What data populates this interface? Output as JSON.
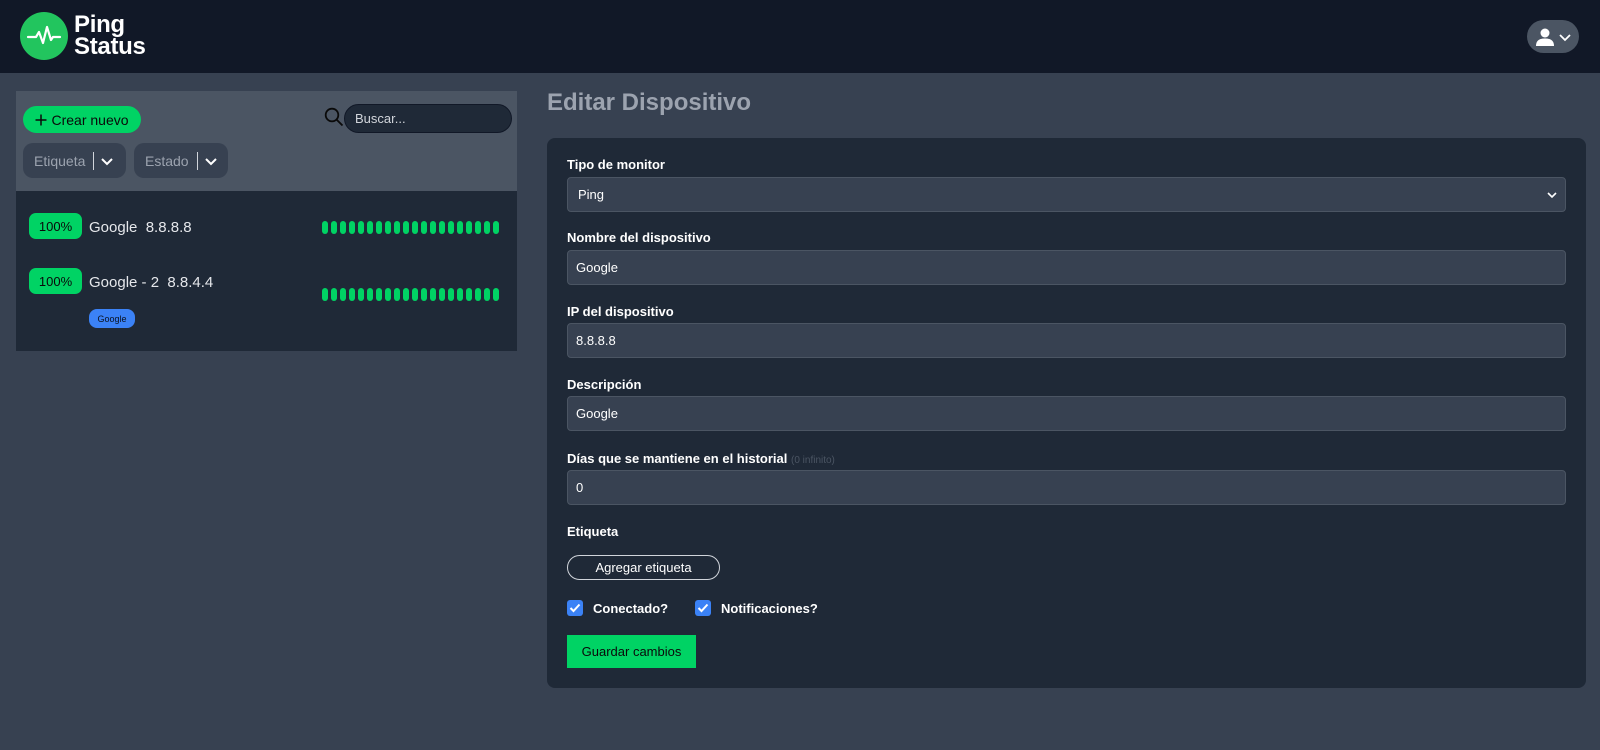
{
  "app": {
    "logo_line1": "Ping",
    "logo_line2": "Status"
  },
  "sidebar": {
    "create_label": "Crear nuevo",
    "search": {
      "placeholder": "Buscar..."
    },
    "filters": [
      {
        "label": "Etiqueta"
      },
      {
        "label": "Estado"
      }
    ],
    "devices": [
      {
        "uptime": "100%",
        "name": "Google",
        "ip": "8.8.8.8",
        "tags": [],
        "history_bars": 20
      },
      {
        "uptime": "100%",
        "name": "Google - 2",
        "ip": "8.8.4.4",
        "tags": [
          "Google"
        ],
        "history_bars": 20
      }
    ]
  },
  "main": {
    "title": "Editar Dispositivo",
    "form": {
      "monitor_type_label": "Tipo de monitor",
      "monitor_type_value": "Ping",
      "device_name_label": "Nombre del dispositivo",
      "device_name_value": "Google",
      "device_ip_label": "IP del dispositivo",
      "device_ip_value": "8.8.8.8",
      "description_label": "Descripción",
      "description_value": "Google",
      "history_days_label": "Días que se mantiene en el historial",
      "history_days_hint": "(0 infinito)",
      "history_days_value": "0",
      "tag_label": "Etiqueta",
      "add_tag_label": "Agregar etiqueta",
      "connected_label": "Conectado?",
      "connected_checked": true,
      "notifications_label": "Notificaciones?",
      "notifications_checked": true,
      "save_label": "Guardar cambios"
    }
  },
  "colors": {
    "accent_green": "#00d364",
    "tag_blue": "#3b82f6",
    "topbar": "#111827",
    "background": "#374151"
  }
}
